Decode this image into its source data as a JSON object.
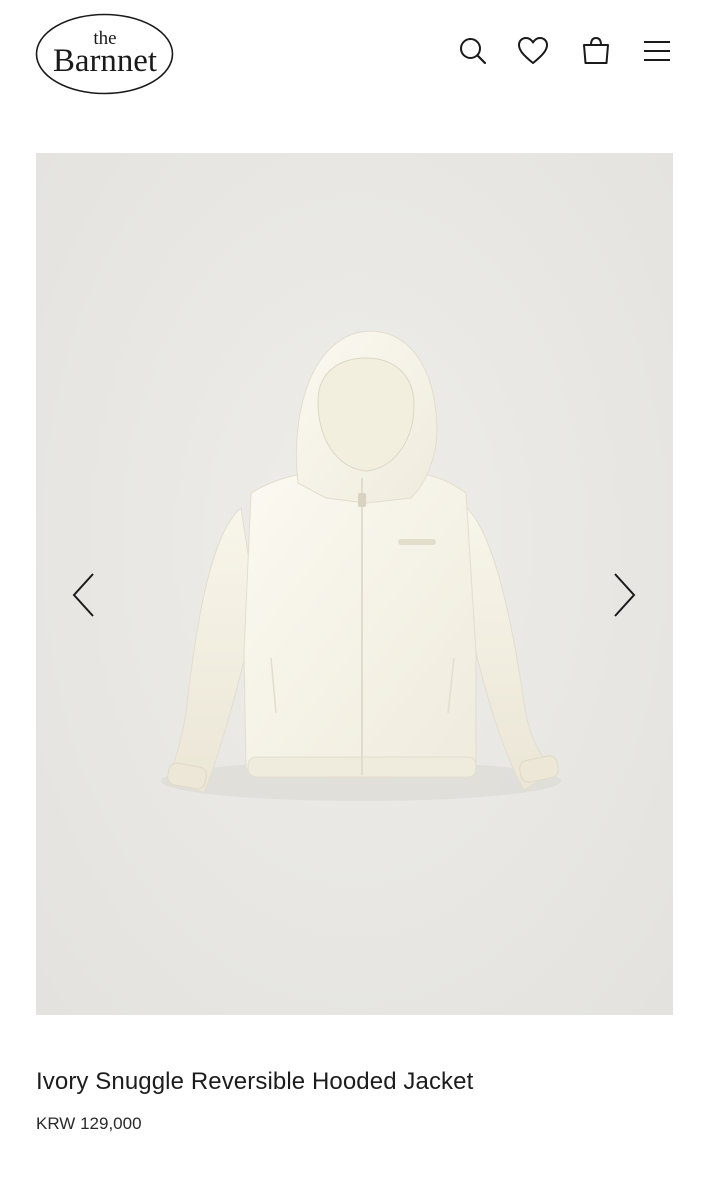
{
  "header": {
    "logo": {
      "line1": "the",
      "line2": "Barnnet"
    },
    "icons": [
      "search-icon",
      "heart-icon",
      "shopping-bag-icon",
      "menu-icon"
    ]
  },
  "gallery": {
    "image_alt": "Ivory hooded jacket",
    "prev_icon": "chevron-left-icon",
    "next_icon": "chevron-right-icon"
  },
  "product": {
    "title": "Ivory Snuggle Reversible Hooded Jacket",
    "price": "KRW 129,000"
  },
  "colors": {
    "background": "#ffffff",
    "image_bg": "#e9e8e4",
    "jacket": "#f6f3e8",
    "text": "#1c1c1c"
  }
}
